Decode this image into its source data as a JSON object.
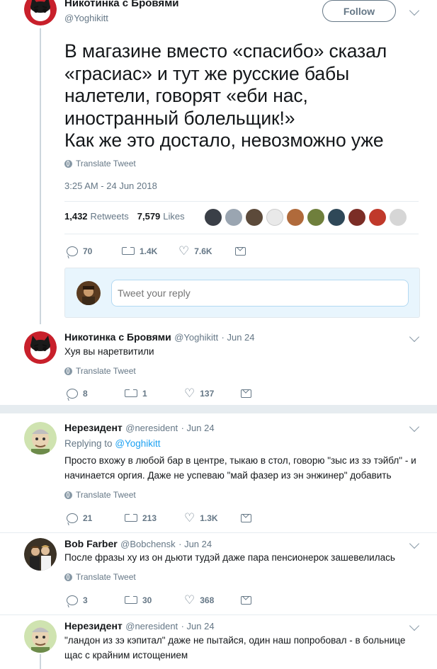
{
  "main_tweet": {
    "name": "Никотинка с Бровями",
    "handle": "@Yoghikitt",
    "follow_label": "Follow",
    "text": "В магазине вместо «спасибо» сказал «грасиас» и тут же русские бабы налетели, говорят «еби нас, иностранный болельщик!»\nКак же это достало, невозможно уже",
    "translate": "Translate Tweet",
    "timestamp": "3:25 AM - 24 Jun 2018",
    "retweets_count": "1,432",
    "retweets_label": "Retweets",
    "likes_count": "7,579",
    "likes_label": "Likes",
    "actions": {
      "replies": "70",
      "retweets": "1.4K",
      "likes": "7.6K"
    },
    "reply_placeholder": "Tweet your reply"
  },
  "replies": [
    {
      "name": "Никотинка с Бровями",
      "handle": "@Yoghikitt",
      "date": "· Jun 24",
      "text": "Хуя вы наретвитили",
      "translate": "Translate Tweet",
      "actions": {
        "replies": "8",
        "retweets": "1",
        "likes": "137"
      }
    },
    {
      "name": "Нерезидент",
      "handle": "@neresident",
      "date": "· Jun 24",
      "replying_label": "Replying to",
      "replying_to": "@Yoghikitt",
      "text": "Просто вхожу в любой бар в центре, тыкаю в стол, говорю \"зыс из зэ тэйбл\" - и начинается оргия. Даже не успеваю \"май фазер из эн энжинер\" добавить",
      "translate": "Translate Tweet",
      "actions": {
        "replies": "21",
        "retweets": "213",
        "likes": "1.3K"
      }
    },
    {
      "name": "Bob Farber",
      "handle": "@Bobchensk",
      "date": "· Jun 24",
      "text": "После фразы ху из он дьюти тудэй даже пара пенсионерок зашевелилась",
      "translate": "Translate Tweet",
      "actions": {
        "replies": "3",
        "retweets": "30",
        "likes": "368"
      }
    },
    {
      "name": "Нерезидент",
      "handle": "@neresident",
      "date": "· Jun 24",
      "text": "\"ландон из зэ кэпитал\" даже не пытайся, один наш попробовал - в больнице щас с крайним истощением"
    }
  ],
  "colors": {
    "accent": "#1da1f2",
    "muted": "#657786",
    "text": "#14171a",
    "border": "#e6ecf0"
  }
}
